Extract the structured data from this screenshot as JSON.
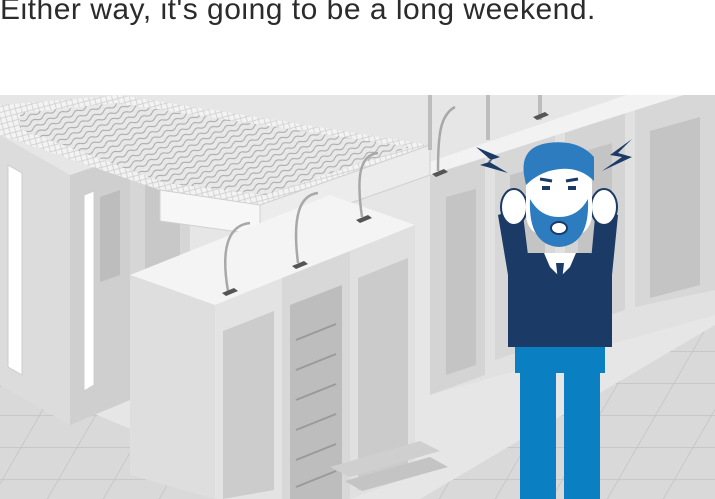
{
  "caption": {
    "text": "Either way, it's going to be a long weekend."
  },
  "illustration": {
    "subject": "person-holding-head",
    "colors": {
      "shirt": "#1b3a66",
      "pants": "#0a7fc1",
      "hair": "#2e7cc0",
      "floor": "#d7d7d7",
      "rack_light": "#ececec",
      "rack_dark": "#b9b9b9"
    }
  }
}
